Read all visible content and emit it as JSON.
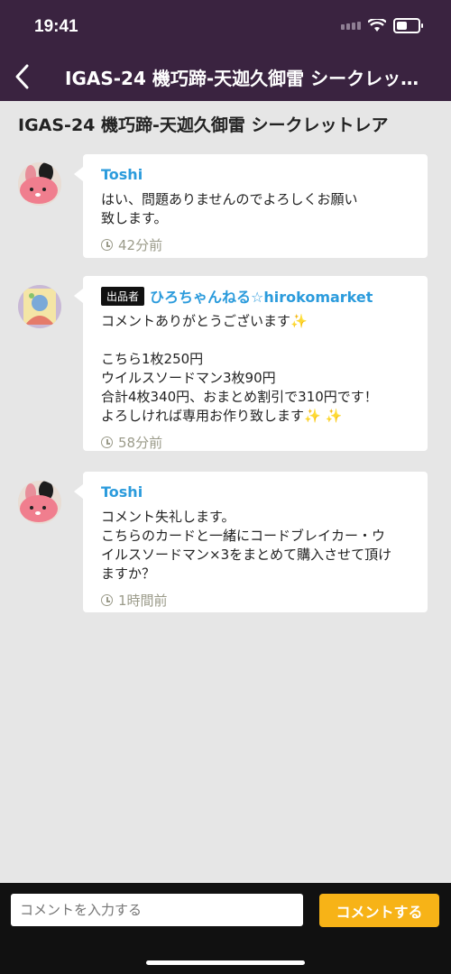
{
  "status_bar": {
    "time": "19:41"
  },
  "header": {
    "title": "IGAS-24 機巧蹄-天迦久御雷 シークレットレ…"
  },
  "page_title": "IGAS-24 機巧蹄-天迦久御雷 シークレットレア",
  "comments": [
    {
      "author": "Toshi",
      "text": "はい、問題ありませんのでよろしくお願い\n致します。",
      "time": "42分前"
    },
    {
      "badge": "出品者",
      "author": "ひろちゃんねる☆hirokomarket",
      "text": "コメントありがとうございます✨\n\nこちら1枚250円\nウイルスソードマン3枚90円\n合計4枚340円、おまとめ割引で310円です！\nよろしければ専用お作り致します✨ ✨",
      "time": "58分前"
    },
    {
      "author": "Toshi",
      "text": "コメント失礼します。\nこちらのカードと一緒にコードブレイカー・ウ\nイルスソードマン×3をまとめて購入させて頂け\nますか？",
      "time": "1時間前"
    }
  ],
  "composer": {
    "placeholder": "コメントを入力する",
    "button": "コメントする"
  },
  "colors": {
    "header_bg": "#3a2340",
    "author": "#2b9bdc",
    "accent": "#f7b317"
  }
}
